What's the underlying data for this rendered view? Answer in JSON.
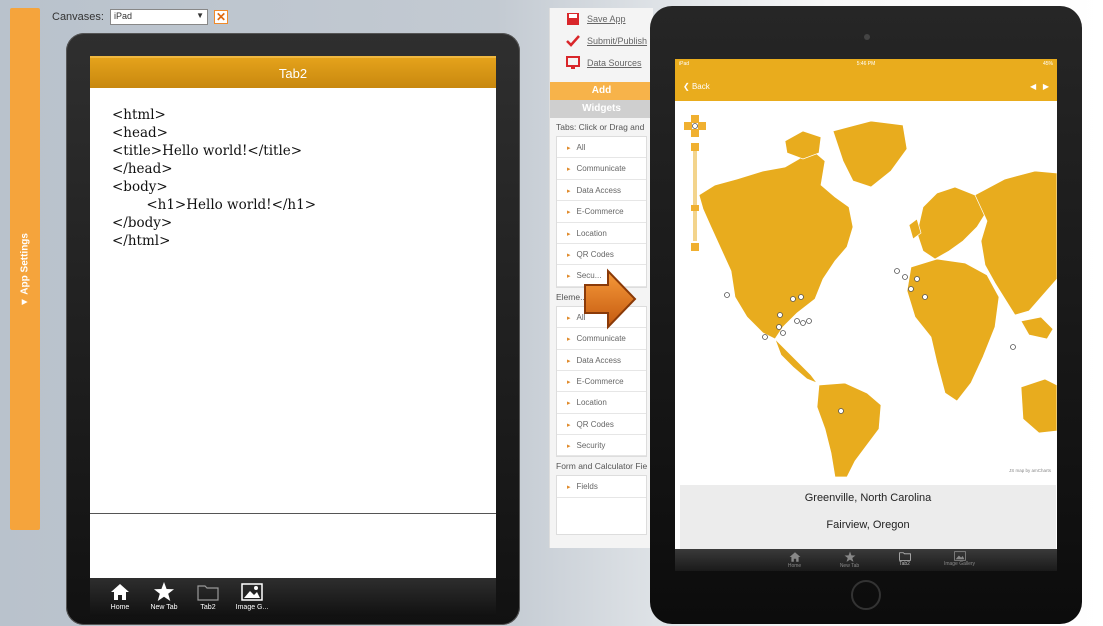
{
  "canvases": {
    "label": "Canvases:",
    "selected": "iPad"
  },
  "app_settings": {
    "label": "▼ App Settings"
  },
  "left_ipad": {
    "tab_title": "Tab2",
    "code": "<html>\n<head>\n<title>Hello world!</title>\n</head>\n<body>\n        <h1>Hello world!</h1>\n</body>\n</html>",
    "tabs": [
      "Home",
      "New Tab",
      "Tab2",
      "Image G..."
    ]
  },
  "panel": {
    "actions": [
      "Save App",
      "Submit/Publish",
      "Data Sources"
    ],
    "add_label": "Add",
    "widgets_label": "Widgets",
    "tabs_section": "Tabs: Click or Drag and",
    "tabs_items": [
      "All",
      "Communicate",
      "Data Access",
      "E-Commerce",
      "Location",
      "QR Codes",
      "Secu..."
    ],
    "elements_section": "Eleme...",
    "elements_items": [
      "All",
      "Communicate",
      "Data Access",
      "E-Commerce",
      "Location",
      "QR Codes",
      "Security"
    ],
    "form_section": "Form and Calculator Fie",
    "form_items": [
      "Fields"
    ]
  },
  "right_ipad": {
    "status_left": "iPad",
    "status_time": "5:46 PM",
    "status_right": "45%",
    "back_label": "Back",
    "map_credit": "JS map by amCharts",
    "locations": [
      "Greenville, North Carolina",
      "Fairview, Oregon"
    ],
    "tabs": [
      "Home",
      "New Tab",
      "Tab2",
      "Image Gallery"
    ]
  },
  "colors": {
    "accent": "#e9ac1d",
    "settings_bar": "#f5a43c",
    "tab_header": "#d89614"
  }
}
